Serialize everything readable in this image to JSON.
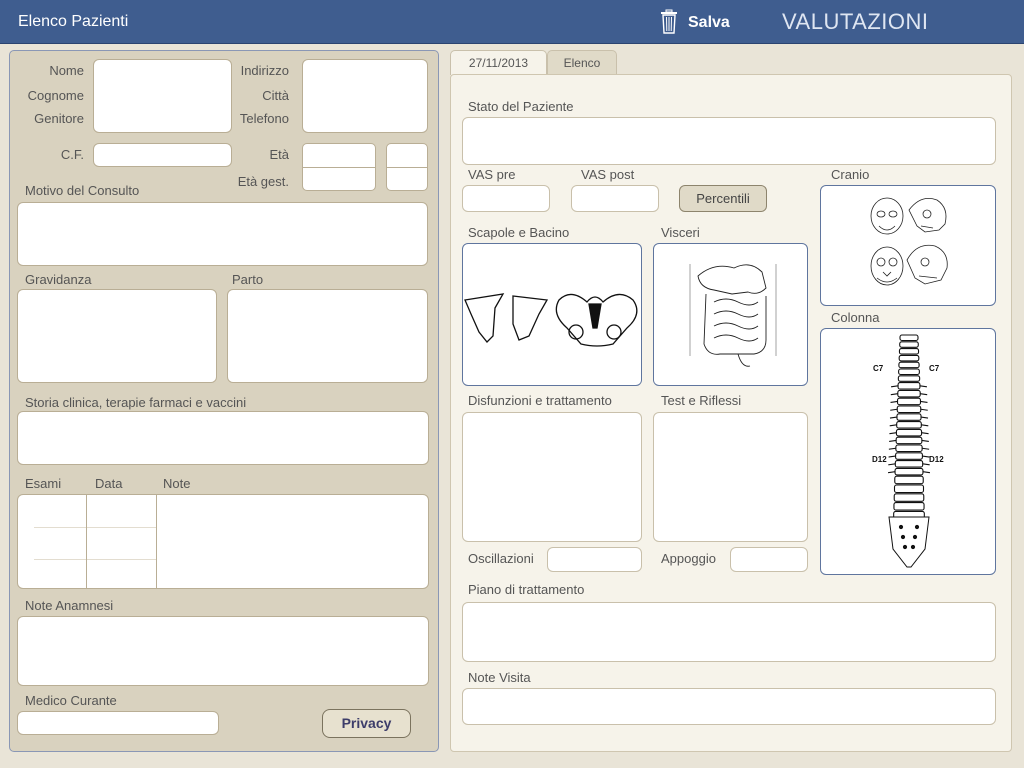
{
  "topbar": {
    "back_label": "Elenco Pazienti",
    "save_label": "Salva",
    "section_title": "VALUTAZIONI"
  },
  "patient": {
    "nome_label": "Nome",
    "cognome_label": "Cognome",
    "genitore_label": "Genitore",
    "indirizzo_label": "Indirizzo",
    "citta_label": "Città",
    "telefono_label": "Telefono",
    "cf_label": "C.F.",
    "eta_label": "Età",
    "eta_gest_label": "Età gest.",
    "motivo_label": "Motivo del Consulto",
    "gravidanza_label": "Gravidanza",
    "parto_label": "Parto",
    "storia_label": "Storia clinica, terapie farmaci e vaccini",
    "esami_label": "Esami",
    "data_label": "Data",
    "note_label": "Note",
    "note_anamnesi_label": "Note Anamnesi",
    "medico_label": "Medico Curante",
    "privacy_label": "Privacy"
  },
  "tabs": [
    {
      "label": "27/11/2013",
      "active": true
    },
    {
      "label": "Elenco",
      "active": false
    }
  ],
  "evaluation": {
    "stato_label": "Stato del Paziente",
    "vas_pre_label": "VAS pre",
    "vas_post_label": "VAS post",
    "percentili_label": "Percentili",
    "cranio_label": "Cranio",
    "scapole_label": "Scapole e Bacino",
    "visceri_label": "Visceri",
    "colonna_label": "Colonna",
    "disfunzioni_label": "Disfunzioni e trattamento",
    "test_label": "Test e Riflessi",
    "oscillazioni_label": "Oscillazioni",
    "appoggio_label": "Appoggio",
    "piano_label": "Piano di trattamento",
    "note_visita_label": "Note Visita",
    "spine_labels": {
      "c7_left": "C7",
      "c7_right": "C7",
      "d12_left": "D12",
      "d12_right": "D12"
    }
  },
  "colors": {
    "topbar": "#3f5d8f",
    "left_panel": "#d9d2bf",
    "right_panel": "#f6f3ea",
    "image_border": "#5f759e"
  }
}
